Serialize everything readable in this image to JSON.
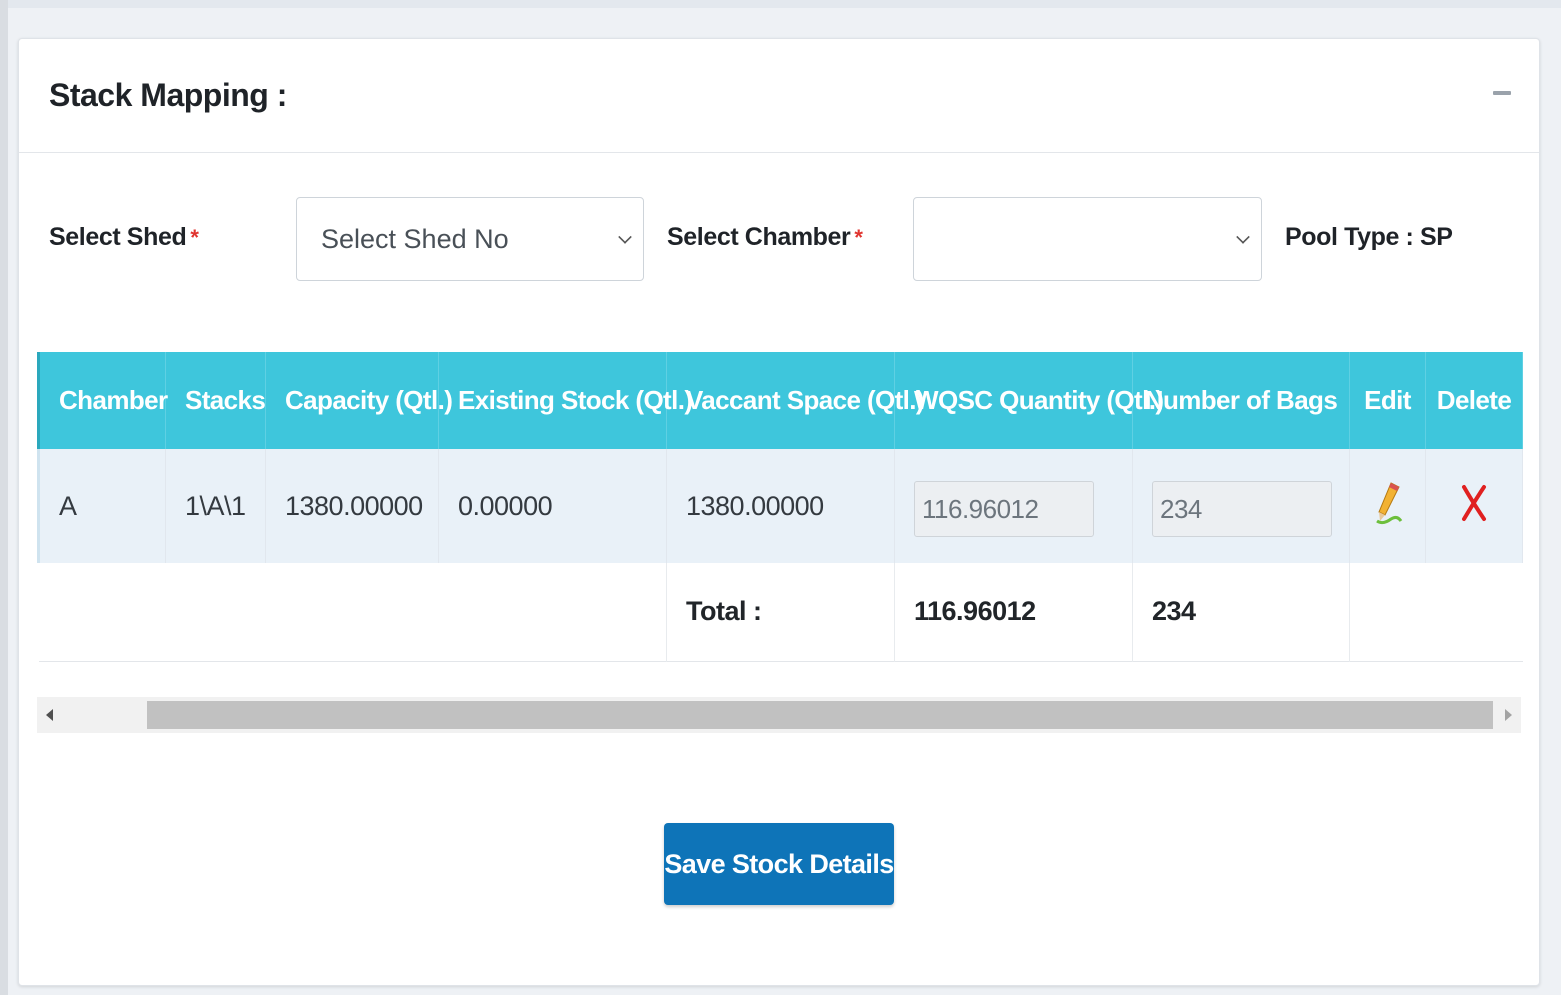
{
  "panel": {
    "title": "Stack Mapping :"
  },
  "form": {
    "shed_label": "Select Shed",
    "shed_required": "*",
    "shed_selected": "Select Shed No",
    "chamber_label": "Select Chamber",
    "chamber_required": "*",
    "chamber_selected": "",
    "pool_type": "Pool Type : SP"
  },
  "table": {
    "headers": [
      "Chamber",
      "Stacks",
      "Capacity (Qtl.)",
      "Existing Stock (Qtl.)",
      "Vaccant Space (Qtl.)",
      "WQSC Quantity (Qtl.)",
      "Number of Bags",
      "Edit",
      "Delete"
    ],
    "rows": [
      {
        "chamber": "A",
        "stacks": "1\\A\\1",
        "capacity": "1380.00000",
        "existing_stock": "0.00000",
        "vacant_space": "1380.00000",
        "wqsc_quantity": "116.96012",
        "number_of_bags": "234",
        "edit_icon": "pencil-icon",
        "delete_icon": "cross-icon"
      }
    ],
    "total_label": "Total :",
    "total_wqsc": "116.96012",
    "total_bags": "234"
  },
  "actions": {
    "save_label": "Save Stock Details"
  },
  "colors": {
    "header_bg": "#3ec6dc",
    "row_bg": "#e9f1f8",
    "save_bg": "#0e74b8",
    "required": "#e0342f",
    "delete": "#e02020"
  }
}
